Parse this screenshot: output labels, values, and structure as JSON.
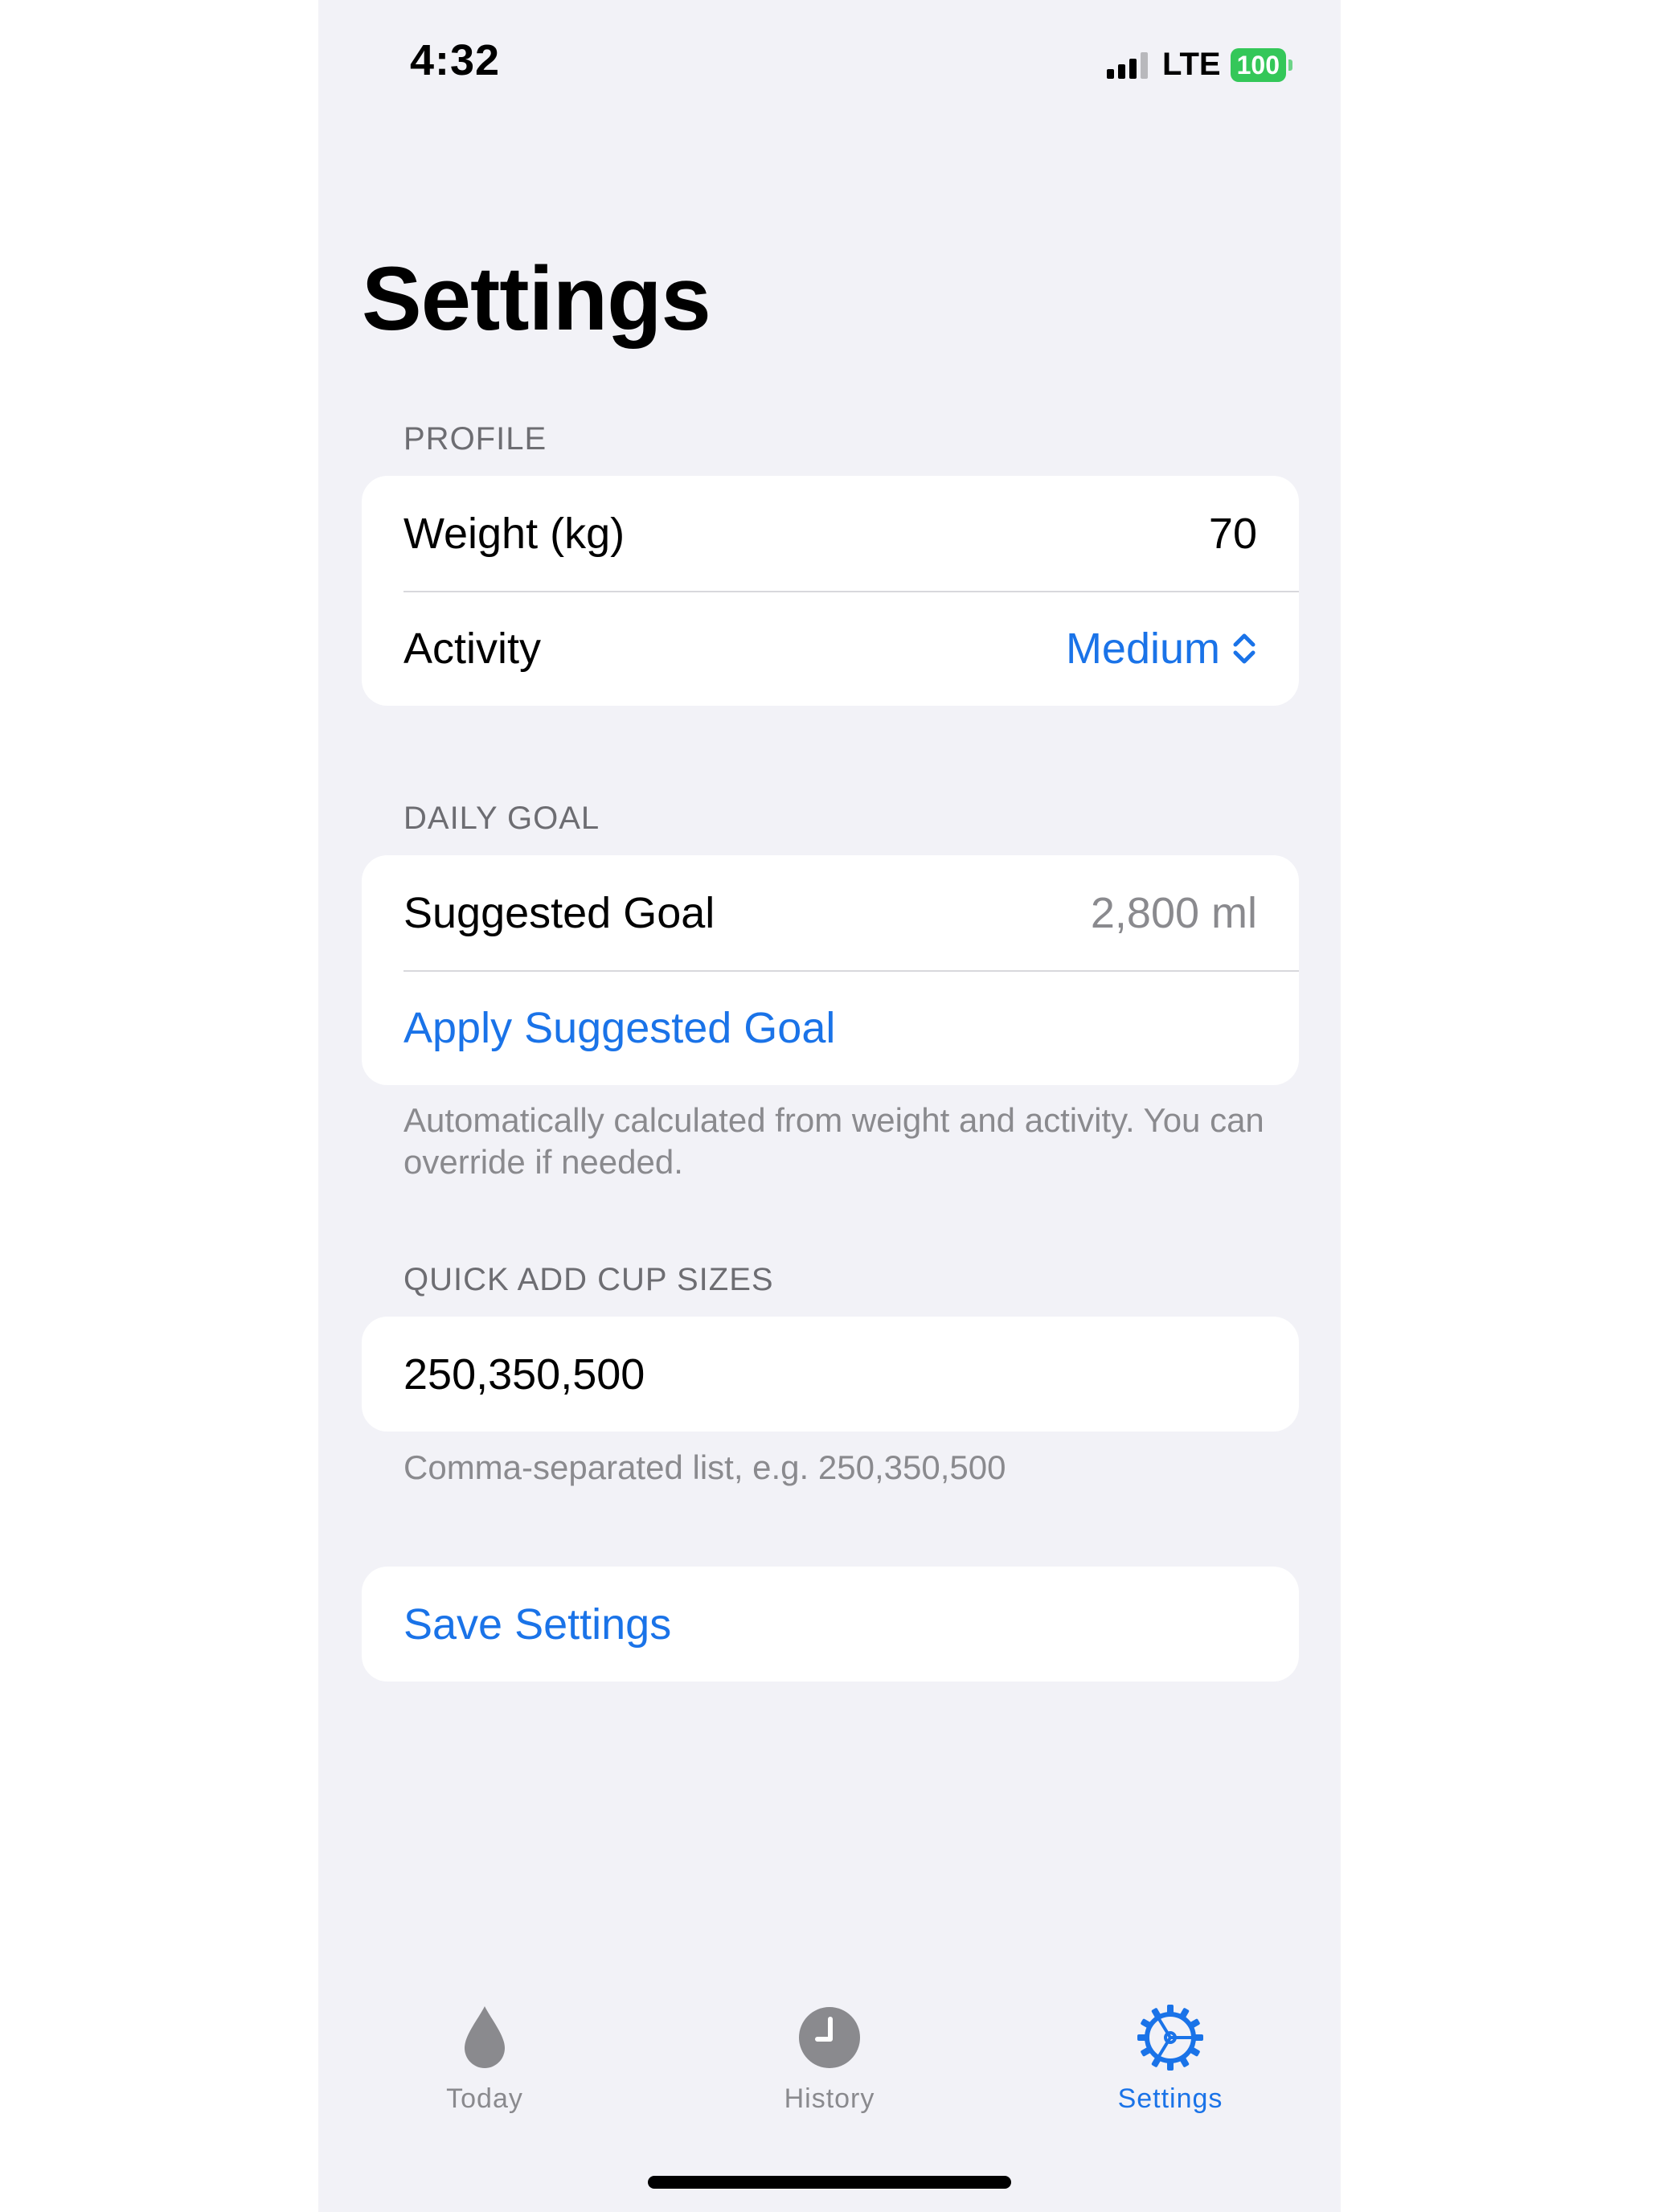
{
  "status_bar": {
    "time": "4:32",
    "network": "LTE",
    "battery": "100"
  },
  "page_title": "Settings",
  "profile": {
    "header": "PROFILE",
    "weight_label": "Weight (kg)",
    "weight_value": "70",
    "activity_label": "Activity",
    "activity_value": "Medium"
  },
  "daily_goal": {
    "header": "DAILY GOAL",
    "suggested_label": "Suggested Goal",
    "suggested_value": "2,800 ml",
    "apply_label": "Apply Suggested Goal",
    "footer": "Automatically calculated from weight and activity. You can override if needed."
  },
  "cup_sizes": {
    "header": "QUICK ADD CUP SIZES",
    "value": "250,350,500",
    "footer": "Comma-separated list, e.g. 250,350,500"
  },
  "save_label": "Save Settings",
  "tabs": [
    {
      "label": "Today",
      "icon": "water-drop-icon"
    },
    {
      "label": "History",
      "icon": "clock-icon"
    },
    {
      "label": "Settings",
      "icon": "gear-icon"
    }
  ],
  "colors": {
    "accent": "#1a73e8",
    "background": "#f2f2f7",
    "battery": "#34c759",
    "inactive": "#8a8a8e"
  }
}
